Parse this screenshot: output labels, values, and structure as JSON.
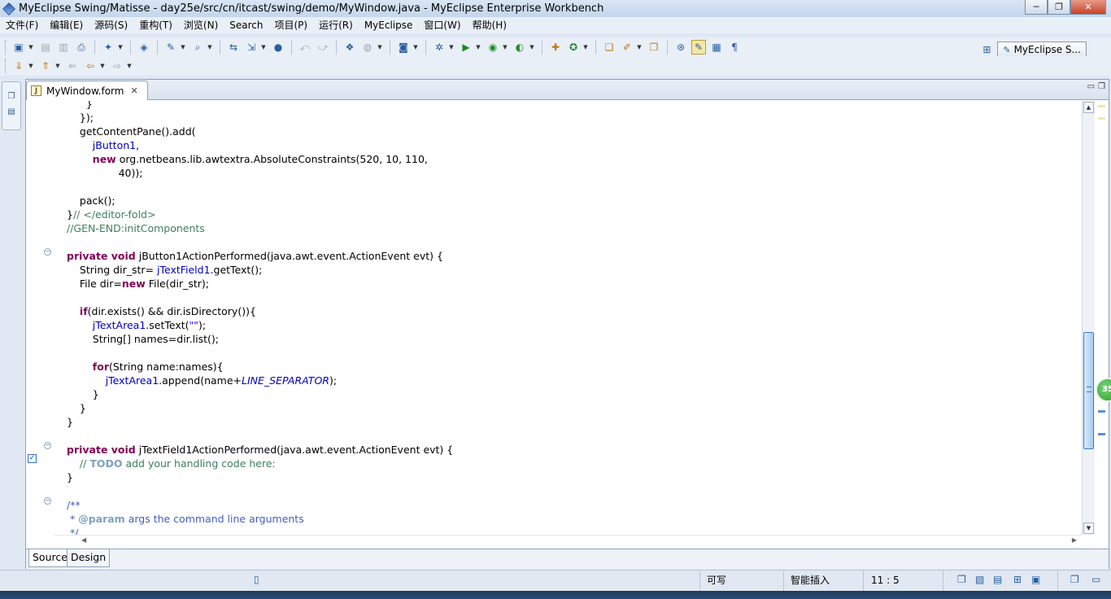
{
  "window": {
    "title": "MyEclipse Swing/Matisse - day25e/src/cn/itcast/swing/demo/MyWindow.java - MyEclipse Enterprise Workbench",
    "controls": {
      "minimize": "─",
      "maximize": "❐",
      "close": "✕"
    }
  },
  "menu": [
    "文件(F)",
    "编辑(E)",
    "源码(S)",
    "重构(T)",
    "浏览(N)",
    "Search",
    "项目(P)",
    "运行(R)",
    "MyEclipse",
    "窗口(W)",
    "帮助(H)"
  ],
  "perspective": {
    "label": "MyEclipse S..."
  },
  "editor": {
    "tab_label": "MyWindow.form",
    "tab_close": "✕"
  },
  "mode_tabs": {
    "source": "Source",
    "design": "Design"
  },
  "status": {
    "writable": "可写",
    "insert_mode": "智能插入",
    "position": "11 : 5"
  },
  "colors": {
    "keyword": "#7f0055",
    "field": "#0000c0",
    "comment": "#3f7f5f",
    "javadoc": "#3f5fbf",
    "scrollbar_thumb": "#a8ccf2"
  },
  "code_lines": {
    "l1": "}",
    "l2": "});",
    "l3": "getContentPane().add(",
    "l4_field": "jButton1",
    "l4_rest": ",",
    "l5_kw": "new",
    "l5_rest": " org.netbeans.lib.awtextra.AbsoluteConstraints(520, 10, 110,",
    "l6": "40));",
    "l8": "pack();",
    "l9_brace": "}",
    "l9_cmt": "// </editor-fold>",
    "l10_cmt": "//GEN-END:initComponents",
    "m1_kw": "private void",
    "m1_rest": " jButton1ActionPerformed(java.awt.event.ActionEvent evt) {",
    "m1_l1_a": "String dir_str= ",
    "m1_l1_fld": "jTextField1",
    "m1_l1_b": ".getText();",
    "m1_l2_a": "File dir=",
    "m1_l2_kw": "new",
    "m1_l2_b": " File(dir_str);",
    "m1_if_kw": "if",
    "m1_if_rest": "(dir.exists() && dir.isDirectory()){",
    "m1_set_fld": "jTextArea1",
    "m1_set_a": ".setText(",
    "m1_set_str": "\"\"",
    "m1_set_b": ");",
    "m1_names": "String[] names=dir.list();",
    "m1_for_kw": "for",
    "m1_for_rest": "(String name:names){",
    "m1_app_fld": "jTextArea1",
    "m1_app_a": ".append(name+",
    "m1_app_sc": "LINE_SEPARATOR",
    "m1_app_b": ");",
    "close": "}",
    "m2_kw": "private void",
    "m2_rest": " jTextField1ActionPerformed(java.awt.event.ActionEvent evt) {",
    "m2_cmt_a": "// ",
    "m2_todo": "TODO",
    "m2_cmt_b": " add your handling code here:",
    "doc_open": "/**",
    "doc_star": " * ",
    "doc_tag": "@param",
    "doc_text": " args the command line arguments",
    "doc_close": " */"
  }
}
